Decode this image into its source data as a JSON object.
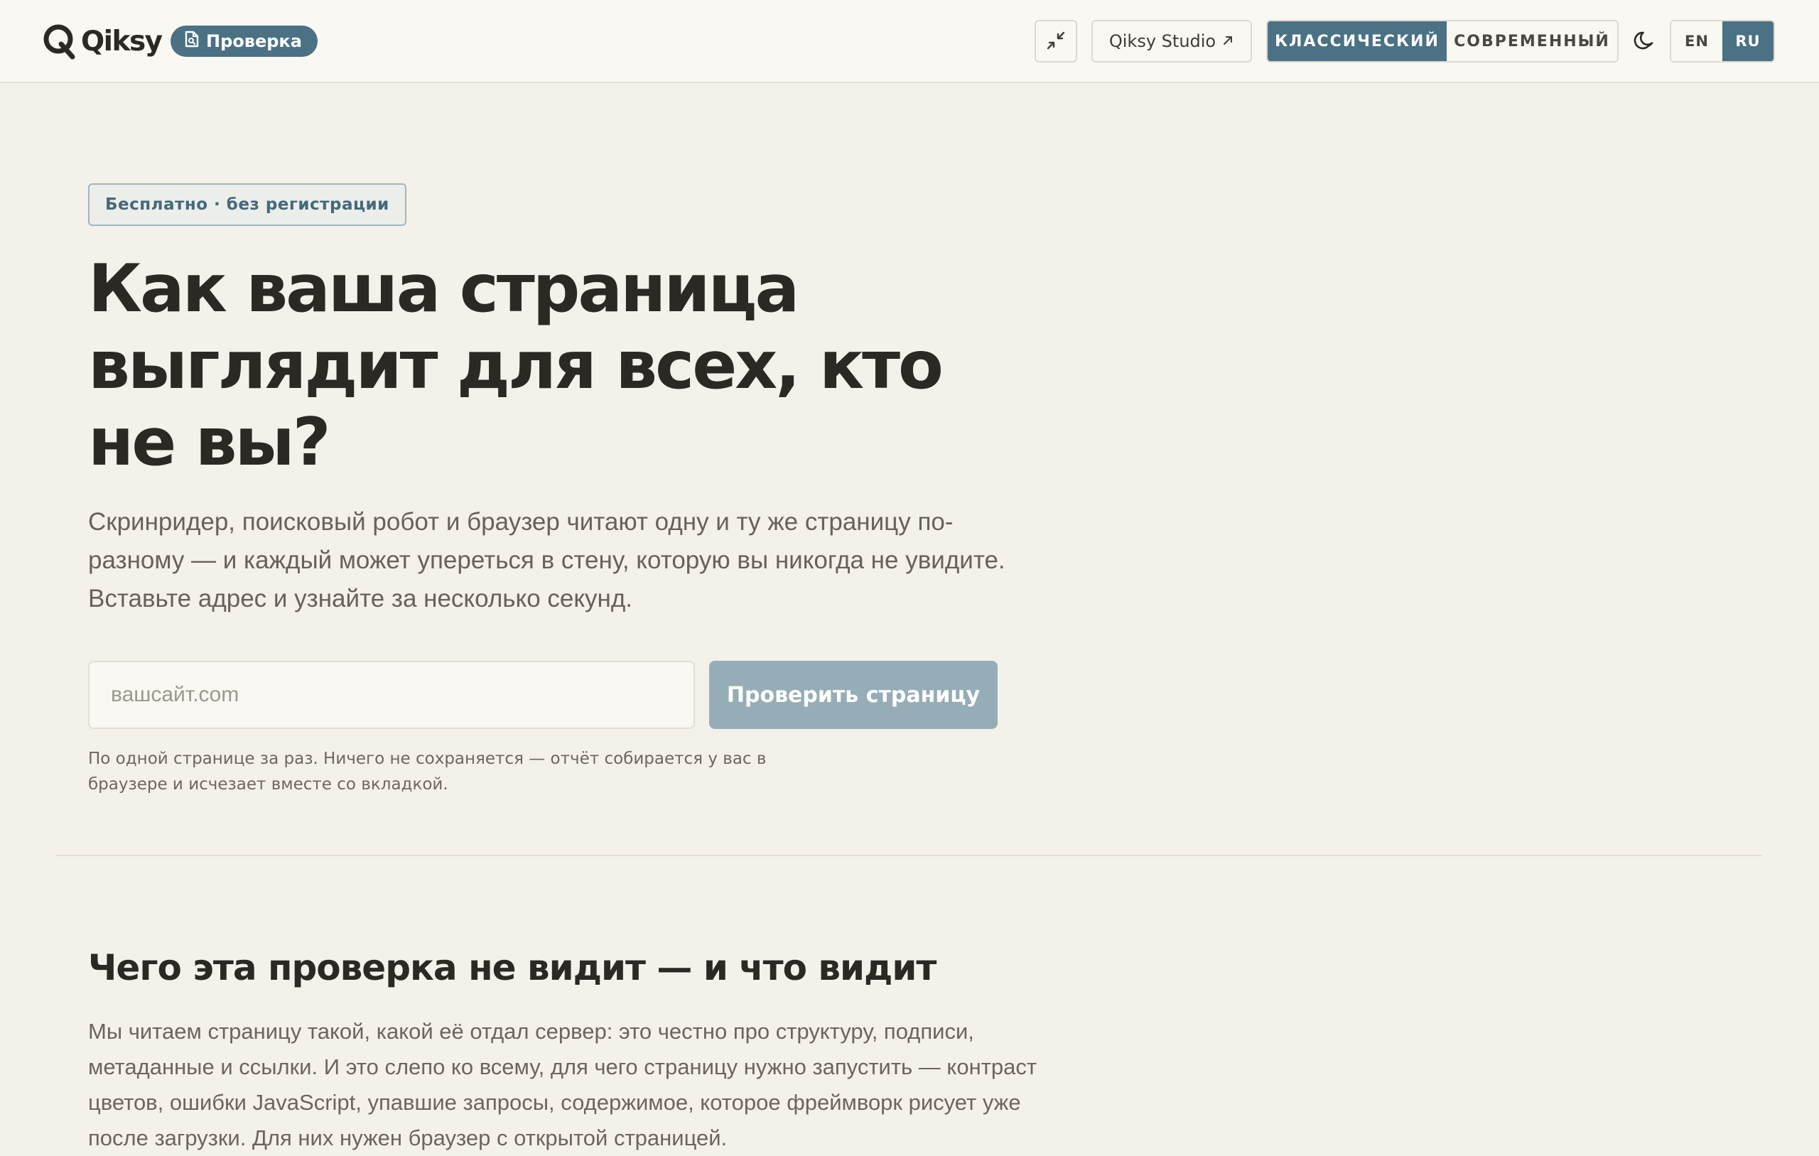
{
  "header": {
    "logo_text": "Qiksy",
    "check_pill_label": "Проверка",
    "studio_label": "Qiksy Studio",
    "style_toggle": {
      "classic": "КЛАССИЧЕСКИЙ",
      "modern": "СОВРЕМЕННЫЙ",
      "selected": "classic"
    },
    "lang_toggle": {
      "en": "EN",
      "ru": "RU",
      "selected": "ru"
    },
    "icons": {
      "logo": "qiksy-logo-icon",
      "pill": "document-check-icon",
      "collapse": "collapse-arrows-icon",
      "external": "external-arrow-icon",
      "theme": "moon-icon"
    }
  },
  "hero": {
    "badge": "Бесплатно · без регистрации",
    "title": "Как ваша страница выглядит для всех, кто не вы?",
    "lead": "Скринридер, поисковый робот и браузер читают одну и ту же страницу по-разному — и каждый может упереться в стену, которую вы никогда не увидите. Вставьте адрес и узнайте за несколько секунд.",
    "input": {
      "value": "",
      "placeholder": "вашсайт.com"
    },
    "submit_label": "Проверить страницу",
    "hint": "По одной странице за раз. Ничего не сохраняется — отчёт собирается у вас в браузере и исчезает вместе со вкладкой."
  },
  "section": {
    "title": "Чего эта проверка не видит — и что видит",
    "body": "Мы читаем страницу такой, какой её отдал сервер: это честно про структуру, подписи, метаданные и ссылки. И это слепо ко всему, для чего страницу нужно запустить — контраст цветов, ошибки JavaScript, упавшие запросы, содержимое, которое фреймворк рисует уже после загрузки. Для них нужен браузер с открытой страницей."
  },
  "colors": {
    "accent": "#4a7184",
    "background": "#f4f1eb",
    "header_bg": "#faf8f3",
    "text": "#2b2924",
    "muted_text": "#66625a",
    "button_disabled": "#95adb6"
  }
}
